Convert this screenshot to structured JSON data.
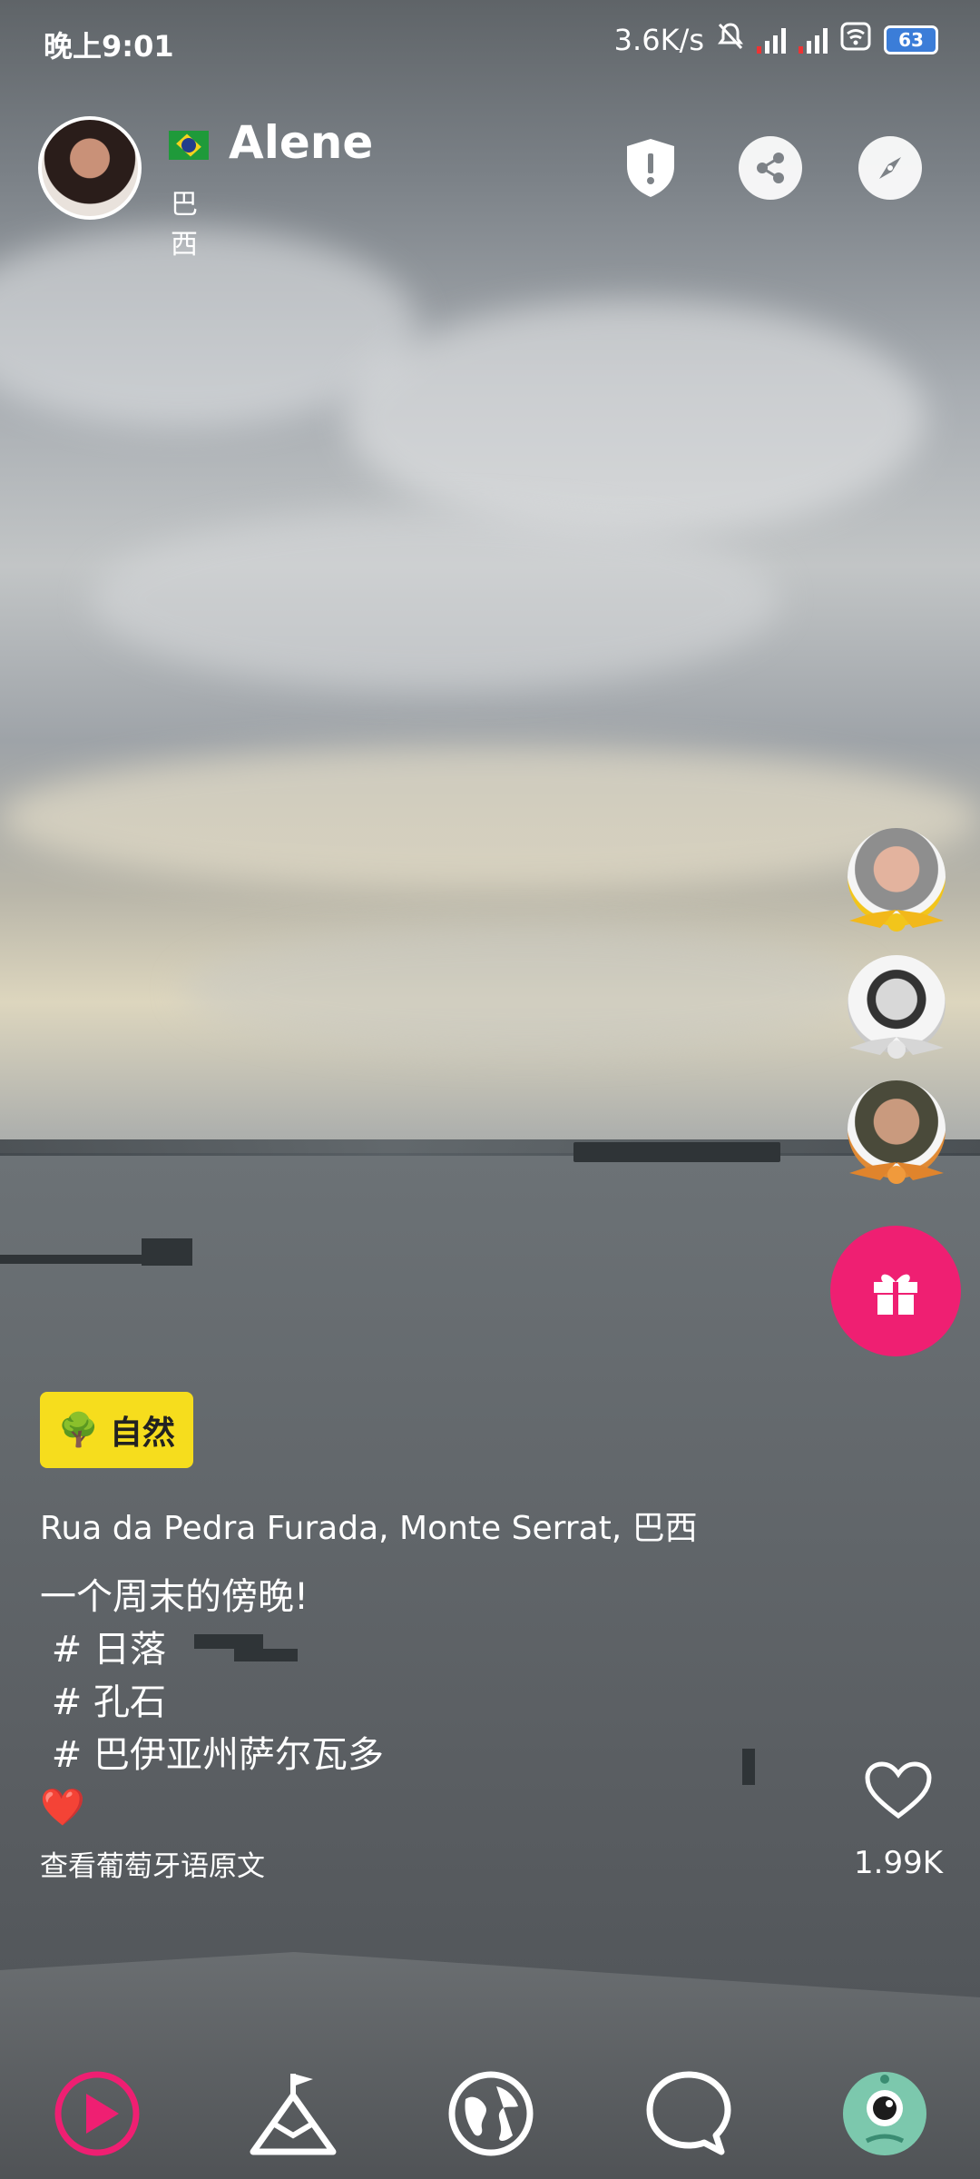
{
  "status_bar": {
    "time": "晚上9:01",
    "network_speed": "3.6K/s",
    "battery": "63"
  },
  "profile": {
    "name": "Alene",
    "country": "巴西",
    "flag_icon": "brazil-flag-icon"
  },
  "header_actions": [
    "shield-icon",
    "share-icon",
    "compass-icon"
  ],
  "category_tag": {
    "emoji": "🌳",
    "label": "自然"
  },
  "location": "Rua da Pedra Furada, Monte Serrat, 巴西",
  "caption": {
    "line1": "一个周末的傍晚!",
    "line2": " # 日落",
    "line3": " # 孔石",
    "line4": " # 巴伊亚州萨尔瓦多",
    "emoji": "❤️"
  },
  "translate_link": "查看葡萄牙语原文",
  "likes": "1.99K",
  "colors": {
    "gift": "#ef1f72",
    "tag": "#f6dd1d",
    "nav_active": "#ef1f72"
  },
  "bottom_nav": [
    "play-icon",
    "mountain-flag-icon",
    "globe-icon",
    "chat-icon",
    "profile-avatar-icon"
  ]
}
